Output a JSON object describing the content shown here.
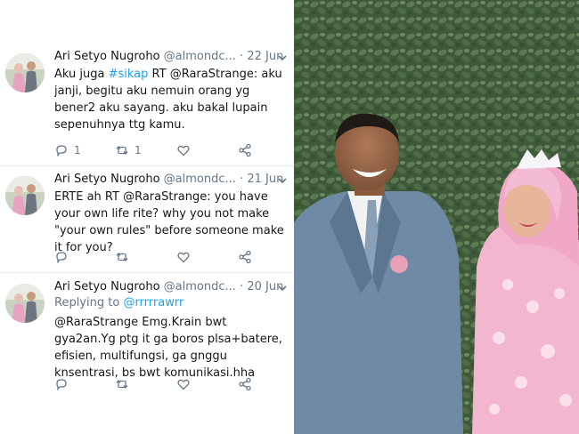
{
  "tweets": [
    {
      "author": "Ari Setyo Nugroho",
      "handle": "@almondc...",
      "separator": "·",
      "date": "22 Jun 12",
      "text_parts": [
        "Aku juga ",
        "#sikap",
        " RT @RaraStrange: aku janji, begitu aku nemuin orang yg bener2 aku sayang. aku bakal lupain sepenuhnya ttg kamu."
      ],
      "replies": "1",
      "retweets": "1",
      "likes": ""
    },
    {
      "author": "Ari Setyo Nugroho",
      "handle": "@almondc...",
      "separator": "·",
      "date": "21 Jun 12",
      "text": "ERTE ah RT @RaraStrange: you have your own life rite? why you not make \"your own rules\" before someone make it for you?",
      "replies": "",
      "retweets": "",
      "likes": ""
    },
    {
      "author": "Ari Setyo Nugroho",
      "handle": "@almondc...",
      "separator": "·",
      "date": "20 Jun 12",
      "replying_prefix": "Replying to",
      "replying_to": "@rrrrrawrr",
      "text": "@RaraStrange Emg.Krain bwt gya2an.Yg ptg it ga boros plsa+batere, efisien, multifungsi, ga gnggu knsentrasi, bs bwt komunikasi.hha",
      "replies": "",
      "retweets": "",
      "likes": ""
    }
  ],
  "icons": {
    "reply": "reply-icon",
    "retweet": "retweet-icon",
    "like": "heart-icon",
    "share": "share-icon",
    "more": "chevron-down-icon"
  },
  "colors": {
    "text": "#14171a",
    "muted": "#657786",
    "link": "#1da1f2",
    "divider": "#e6ecf0"
  }
}
